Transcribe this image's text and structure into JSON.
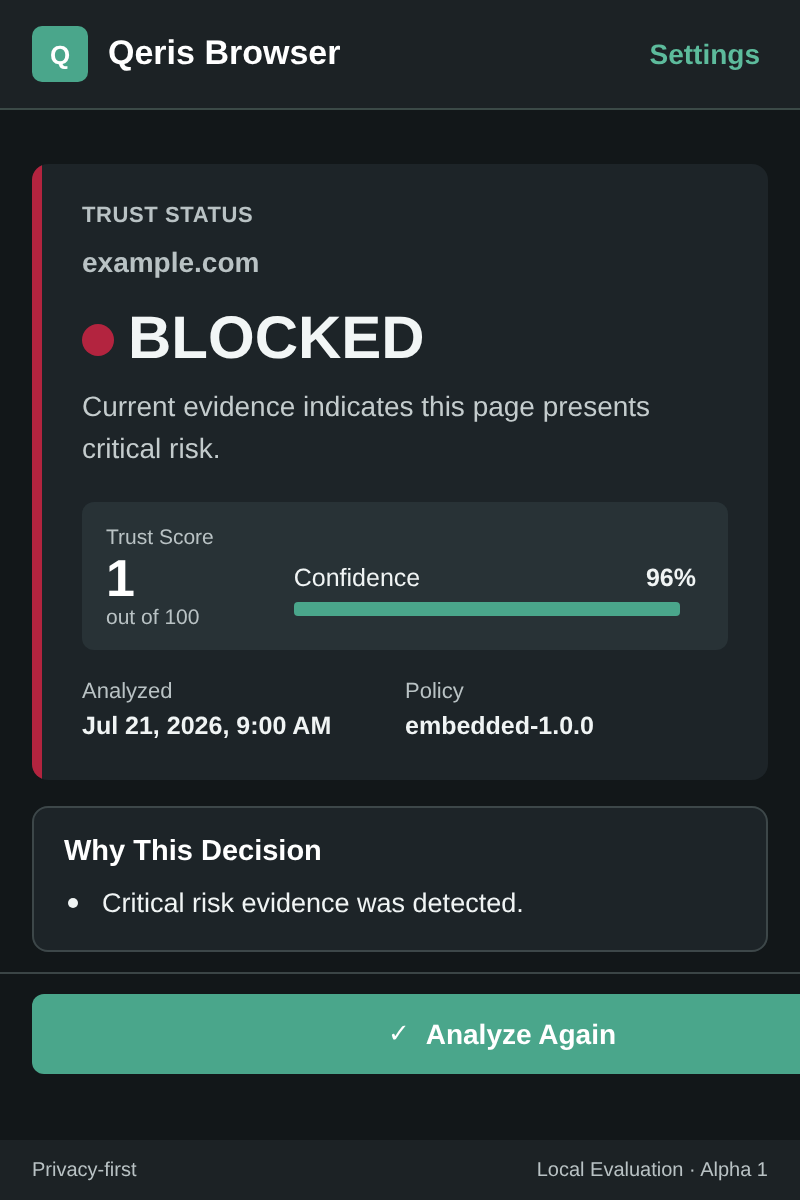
{
  "header": {
    "logo_letter": "Q",
    "title": "Qeris Browser",
    "settings_link": "Settings"
  },
  "trust": {
    "label": "TRUST STATUS",
    "domain": "example.com",
    "status": "BLOCKED",
    "color": "#b3243f",
    "description": "Current evidence indicates this page presents critical risk.",
    "score_label": "Trust Score",
    "score": "1",
    "score_caption": "out of 100",
    "confidence_label": "Confidence",
    "confidence_reading": "96%",
    "level": 0.96,
    "details": [
      {
        "label": "Analyzed",
        "value": "Jul 21, 2026, 9:00 AM"
      },
      {
        "label": "Policy",
        "value": "embedded-1.0.0"
      }
    ]
  },
  "why": {
    "title": "Why This Decision",
    "reasons": [
      "Critical risk evidence was detected."
    ]
  },
  "action": {
    "icon": "✓",
    "label": "Analyze Again"
  },
  "footer": {
    "left": "Privacy-first",
    "right": "Local Evaluation · Alpha 1"
  }
}
